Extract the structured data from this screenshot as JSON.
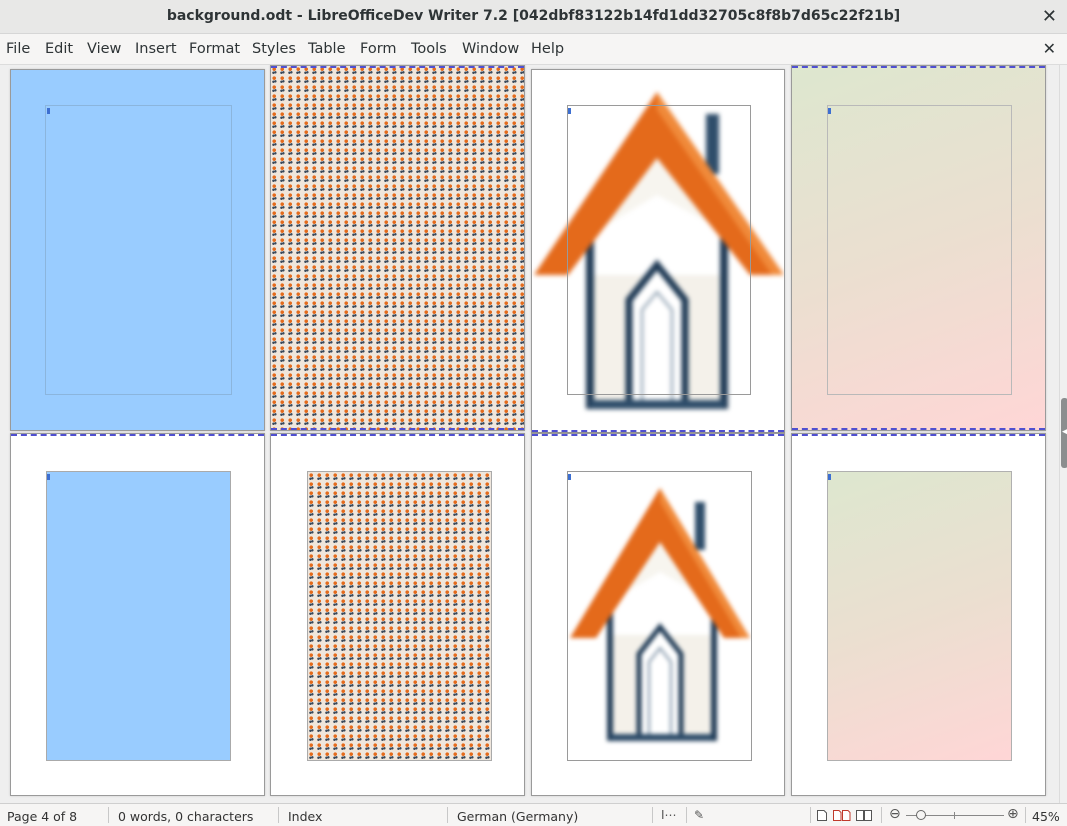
{
  "window": {
    "title": "background.odt - LibreOfficeDev Writer 7.2 [042dbf83122b14fd1dd32705c8f8b7d65c22f21b]"
  },
  "menu": [
    "File",
    "Edit",
    "View",
    "Insert",
    "Format",
    "Styles",
    "Table",
    "Form",
    "Tools",
    "Window",
    "Help"
  ],
  "status": {
    "page": "Page 4 of 8",
    "words": "0 words, 0 characters",
    "page_style": "Index",
    "language": "German (Germany)",
    "zoom": "45%"
  },
  "icons": {
    "window_close": "✕",
    "document_close": "✕",
    "zoom_out": "⊖",
    "zoom_in": "⊕",
    "insert_mode": "I⋯",
    "signature": "✎"
  },
  "colors": {
    "page_fill_blue": "#99ccff",
    "roof_orange": "#e46a1b",
    "house_outline": "#1f3a55",
    "pagebreak_dash": "#5050d0"
  },
  "pages": [
    {
      "fill": "color"
    },
    {
      "fill": "pattern"
    },
    {
      "fill": "image"
    },
    {
      "fill": "gradient"
    },
    {
      "fill": "color"
    },
    {
      "fill": "pattern"
    },
    {
      "fill": "image"
    },
    {
      "fill": "gradient"
    }
  ]
}
